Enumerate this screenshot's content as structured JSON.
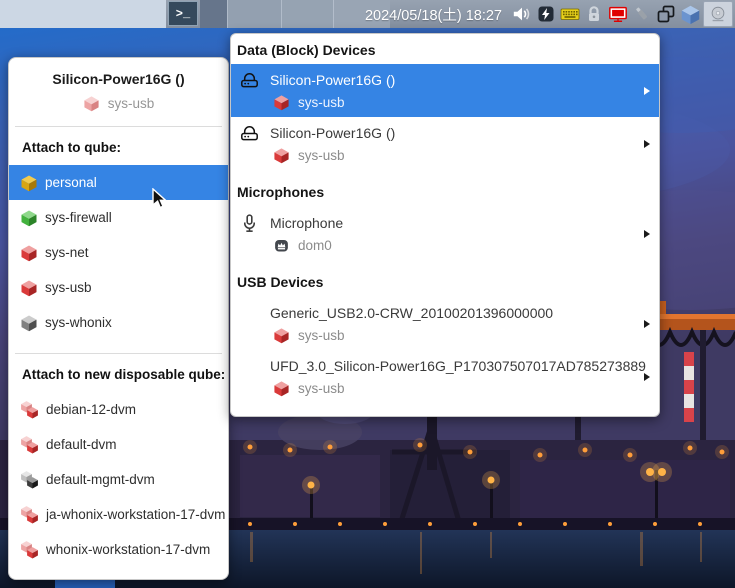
{
  "panel": {
    "clock": "2024/05/18(土) 18:27",
    "terminal_glyph": ">_",
    "tray_icons": [
      "terminal-icon",
      "volume-icon",
      "battery-icon",
      "keyboard-layout-icon",
      "lock-icon",
      "qubes-update-icon",
      "usb-stick-icon",
      "clipboard-icon",
      "qubes-domains-icon",
      "devices-widget-icon"
    ]
  },
  "attach_menu": {
    "device_title": "Silicon-Power16G ()",
    "device_vm": "sys-usb",
    "section_attach": "Attach to qube:",
    "qubes": [
      {
        "label": "personal",
        "color": "yellow",
        "selected": true
      },
      {
        "label": "sys-firewall",
        "color": "green",
        "selected": false
      },
      {
        "label": "sys-net",
        "color": "red",
        "selected": false
      },
      {
        "label": "sys-usb",
        "color": "red",
        "selected": false
      },
      {
        "label": "sys-whonix",
        "color": "gray",
        "selected": false
      }
    ],
    "section_disposable": "Attach to new disposable qube:",
    "disposables": [
      {
        "label": "debian-12-dvm",
        "color": "red"
      },
      {
        "label": "default-dvm",
        "color": "red"
      },
      {
        "label": "default-mgmt-dvm",
        "color": "black"
      },
      {
        "label": "ja-whonix-workstation-17-dvm",
        "color": "red"
      },
      {
        "label": "whonix-workstation-17-dvm",
        "color": "red"
      }
    ]
  },
  "devices_menu": {
    "sections": [
      {
        "header": "Data (Block) Devices",
        "items": [
          {
            "name": "Silicon-Power16G ()",
            "vm": "sys-usb",
            "icon": "drive-icon",
            "selected": true
          },
          {
            "name": "Silicon-Power16G ()",
            "vm": "sys-usb",
            "icon": "drive-icon",
            "selected": false
          }
        ]
      },
      {
        "header": "Microphones",
        "items": [
          {
            "name": "Microphone",
            "vm": "dom0",
            "icon": "microphone-icon",
            "selected": false
          }
        ]
      },
      {
        "header": "USB Devices",
        "items": [
          {
            "name": "Generic_USB2.0-CRW_20100201396000000",
            "vm": "sys-usb",
            "selected": false
          },
          {
            "name": "UFD_3.0_Silicon-Power16G_P170307507017AD785273889",
            "vm": "sys-usb",
            "selected": false
          }
        ]
      }
    ]
  },
  "colors": {
    "selection": "#3584e4",
    "qube_red": "#da3a3a",
    "qube_yellow": "#d9a512",
    "qube_green": "#43b23e",
    "panel": "#8c98a9"
  }
}
